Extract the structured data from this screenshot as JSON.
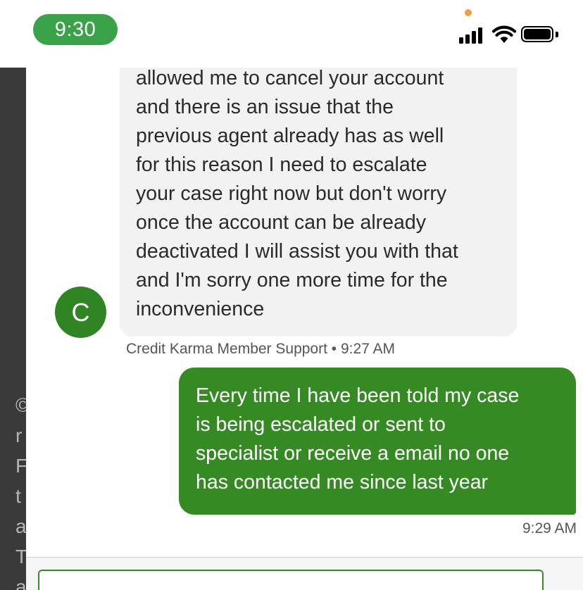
{
  "status_bar": {
    "time": "9:30"
  },
  "background_page": {
    "line_fragments": [
      "©",
      "r",
      "F",
      "t",
      "a",
      "T",
      "a"
    ]
  },
  "chat": {
    "agent_message": {
      "avatar_initial": "C",
      "lines": [
        "allowed me to cancel your account",
        "and there is an issue that the",
        "previous agent already has as well",
        "for this reason I need to escalate",
        "your case right now but don't worry",
        "once the account can be already",
        "deactivated I will assist you with that",
        "and I'm sorry one more time for the",
        "inconvenience"
      ],
      "sender": "Credit Karma Member Support",
      "separator": "•",
      "time": "9:27 AM"
    },
    "user_message": {
      "lines": [
        "Every time I have been told my case",
        "is being escalated or sent to",
        "specialist or receive a email no one",
        "has contacted me since last year"
      ],
      "time": "9:29 AM"
    },
    "composer": {
      "placeholder": ""
    }
  },
  "colors": {
    "brand_green": "#368a23",
    "time_pill": "#3aa34a",
    "agent_bubble": "#f2f2f2"
  }
}
